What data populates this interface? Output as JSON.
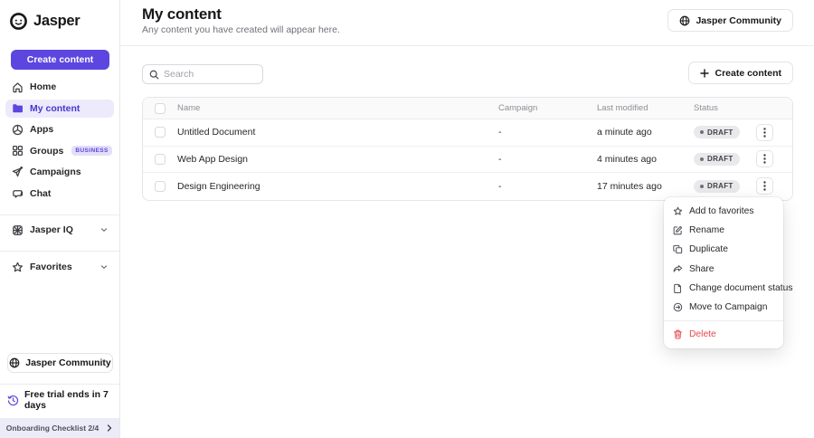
{
  "colors": {
    "brand_purple": "#5b46df",
    "active_nav_bg": "#eceafb",
    "active_nav_text": "#4936ce",
    "badge_bg": "#e4def9",
    "draft_pill_bg": "#e9e9ec",
    "delete_red": "#e5484d",
    "onboarding_bg": "#ecebf8"
  },
  "sidebar": {
    "logo_text": "Jasper",
    "create_button": "Create content",
    "nav": [
      {
        "label": "Home",
        "icon": "home-icon",
        "active": false,
        "badge": null
      },
      {
        "label": "My content",
        "icon": "folder-icon",
        "active": true,
        "badge": null
      },
      {
        "label": "Apps",
        "icon": "apps-icon",
        "active": false,
        "badge": null
      },
      {
        "label": "Groups",
        "icon": "groups-icon",
        "active": false,
        "badge": "BUSINESS"
      },
      {
        "label": "Campaigns",
        "icon": "campaigns-icon",
        "active": false,
        "badge": null
      },
      {
        "label": "Chat",
        "icon": "chat-icon",
        "active": false,
        "badge": null
      }
    ],
    "sections": [
      {
        "label": "Jasper IQ",
        "icon": "jasper-iq-icon"
      },
      {
        "label": "Favorites",
        "icon": "star-icon"
      }
    ],
    "community_button": "Jasper Community",
    "trial_text": "Free trial ends in 7 days",
    "onboarding_label": "Onboarding Checklist 2/4"
  },
  "header": {
    "title": "My content",
    "subtitle": "Any content you have created will appear here.",
    "community_button": "Jasper Community"
  },
  "toolbar": {
    "search_placeholder": "Search",
    "create_button": "Create content"
  },
  "table": {
    "columns": [
      "Name",
      "Campaign",
      "Last modified",
      "Status"
    ],
    "rows": [
      {
        "name": "Untitled Document",
        "campaign": "-",
        "last_modified": "a minute ago",
        "status": "DRAFT"
      },
      {
        "name": "Web App Design",
        "campaign": "-",
        "last_modified": "4 minutes ago",
        "status": "DRAFT"
      },
      {
        "name": "Design Engineering",
        "campaign": "-",
        "last_modified": "17 minutes ago",
        "status": "DRAFT"
      }
    ]
  },
  "context_menu": {
    "items": [
      {
        "label": "Add to favorites",
        "icon": "star-icon"
      },
      {
        "label": "Rename",
        "icon": "rename-icon"
      },
      {
        "label": "Duplicate",
        "icon": "duplicate-icon"
      },
      {
        "label": "Share",
        "icon": "share-icon"
      },
      {
        "label": "Change document status",
        "icon": "document-status-icon"
      },
      {
        "label": "Move to Campaign",
        "icon": "move-campaign-icon"
      }
    ],
    "delete_item": {
      "label": "Delete",
      "icon": "trash-icon"
    }
  }
}
